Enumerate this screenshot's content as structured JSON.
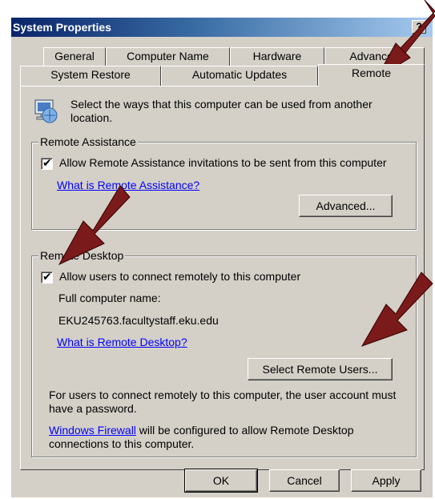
{
  "window": {
    "title": "System Properties",
    "help_label": "?"
  },
  "tabs_row1": [
    "General",
    "Computer Name",
    "Hardware",
    "Advanced"
  ],
  "tabs_row2": [
    "System Restore",
    "Automatic Updates",
    "Remote"
  ],
  "intro": "Select the ways that this computer can be used from another location.",
  "remote_assistance": {
    "legend": "Remote Assistance",
    "checkbox_label": "Allow Remote Assistance invitations to be sent from this computer",
    "checked": true,
    "link": "What is Remote Assistance?",
    "advanced_button": "Advanced..."
  },
  "remote_desktop": {
    "legend": "Remote Desktop",
    "checkbox_label": "Allow users to connect remotely to this computer",
    "checked": true,
    "computer_name_label": "Full computer name:",
    "computer_name": "EKU245763.facultystaff.eku.edu",
    "link": "What is Remote Desktop?",
    "select_users_button": "Select Remote Users...",
    "password_note": "For users to connect remotely to this computer, the user account must have a password.",
    "firewall_link": "Windows Firewall",
    "firewall_note": " will be configured to allow Remote Desktop connections to this computer."
  },
  "footer": {
    "ok": "OK",
    "cancel": "Cancel",
    "apply": "Apply"
  },
  "colors": {
    "arrow": "#7a1a1a",
    "titlebar": "#0a246a",
    "face": "#d4d0c8"
  }
}
